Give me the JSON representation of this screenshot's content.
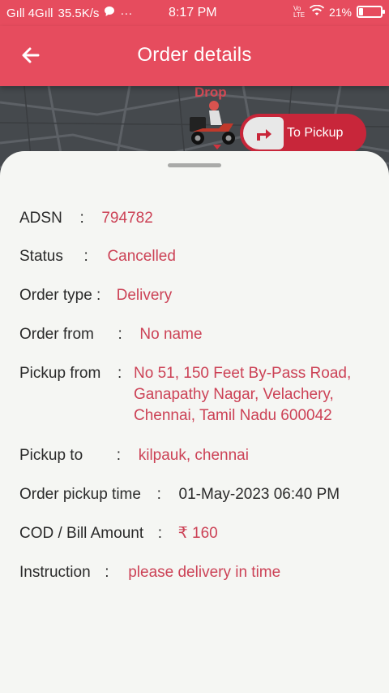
{
  "status_bar": {
    "signal_left": "Gıll 4Gıll",
    "speed": "35.5K/s",
    "more": "···",
    "time": "8:17 PM",
    "volte": "Vo LTE",
    "battery": "21%",
    "battery_level": 0.21
  },
  "app_bar": {
    "title": "Order details",
    "back_icon": "arrow-left-icon"
  },
  "map": {
    "drop_label": "Drop",
    "to_pickup_label": "To Pickup",
    "rider_icon": "delivery-scooter-icon",
    "turn_icon": "turn-right-arrow-icon"
  },
  "details": {
    "adsn": {
      "label": "ADSN",
      "sep": ":",
      "value": "794782"
    },
    "status": {
      "label": "Status",
      "sep": ":",
      "value": "Cancelled"
    },
    "order_type": {
      "label": "Order type :",
      "value": "Delivery"
    },
    "order_from": {
      "label": "Order from",
      "sep": ":",
      "value": "No name"
    },
    "pickup_from": {
      "label": "Pickup from",
      "sep": ":",
      "lines": [
        "No 51, 150 Feet By-Pass Road,",
        "Ganapathy Nagar, Velachery,",
        "Chennai, Tamil Nadu 600042"
      ]
    },
    "pickup_to": {
      "label": "Pickup to",
      "sep": ":",
      "value": "kilpauk, chennai"
    },
    "pickup_time": {
      "label": "Order pickup time",
      "sep": ":",
      "value": "01-May-2023 06:40 PM"
    },
    "bill_amount": {
      "label": "COD / Bill Amount",
      "sep": ":",
      "value": "₹ 160"
    },
    "instruction": {
      "label": "Instruction",
      "sep": ":",
      "value": "please delivery in time"
    }
  },
  "colors": {
    "brand": "#e64c5e",
    "value_text": "#cc4256",
    "label_text": "#2a2a2a",
    "sheet_bg": "#f5f6f3"
  }
}
